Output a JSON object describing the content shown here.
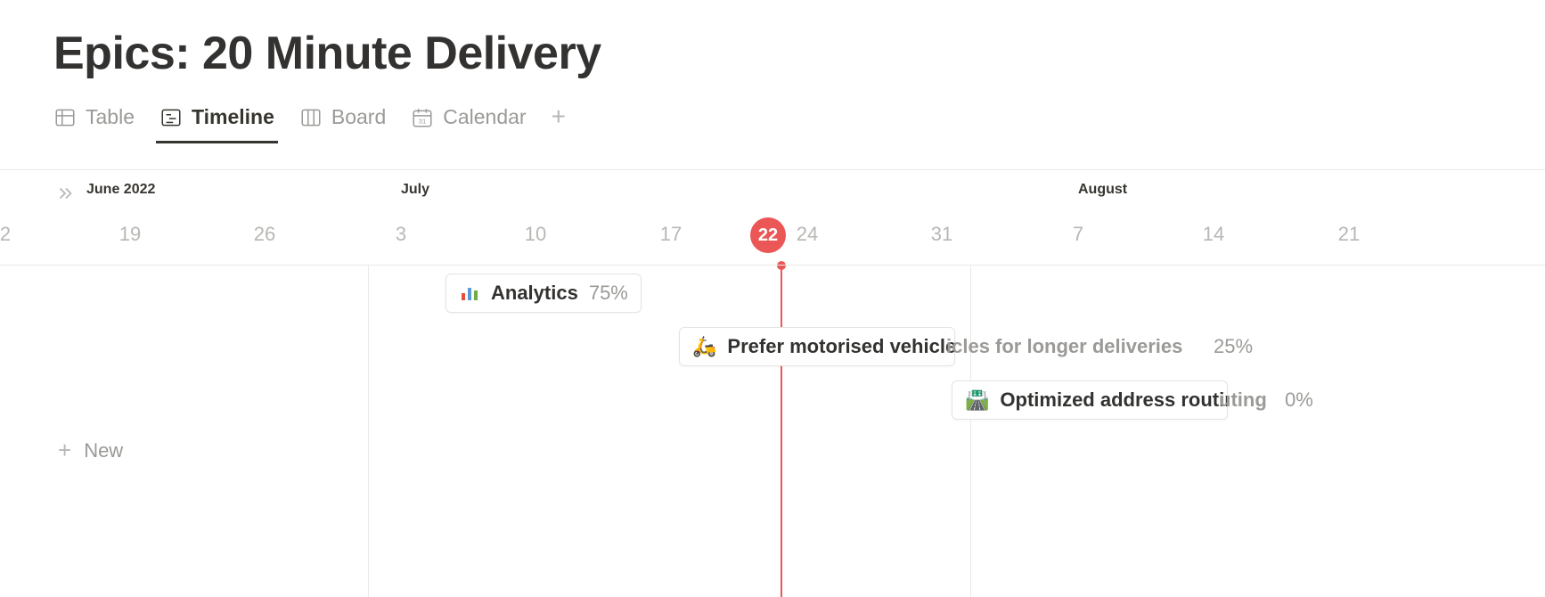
{
  "page_title": "Epics: 20 Minute Delivery",
  "tabs": {
    "table": "Table",
    "timeline": "Timeline",
    "board": "Board",
    "calendar": "Calendar"
  },
  "timeline": {
    "months": {
      "june": "June 2022",
      "july": "July",
      "august": "August"
    },
    "days": {
      "d2": "2",
      "d19": "19",
      "d26": "26",
      "d3": "3",
      "d10": "10",
      "d17": "17",
      "d22": "22",
      "d24": "24",
      "d31": "31",
      "d7": "7",
      "d14": "14",
      "d21": "21"
    },
    "cards": {
      "analytics": {
        "label": "Analytics",
        "pct": "75%"
      },
      "motor": {
        "label": "Prefer motorised vehicles for longer deliveries",
        "pct": "25%",
        "overflow_title": "icles for longer deliveries"
      },
      "routing": {
        "label": "Optimized address routing",
        "pct": "0%",
        "overflow_title": "uting"
      }
    },
    "new_label": "New"
  }
}
